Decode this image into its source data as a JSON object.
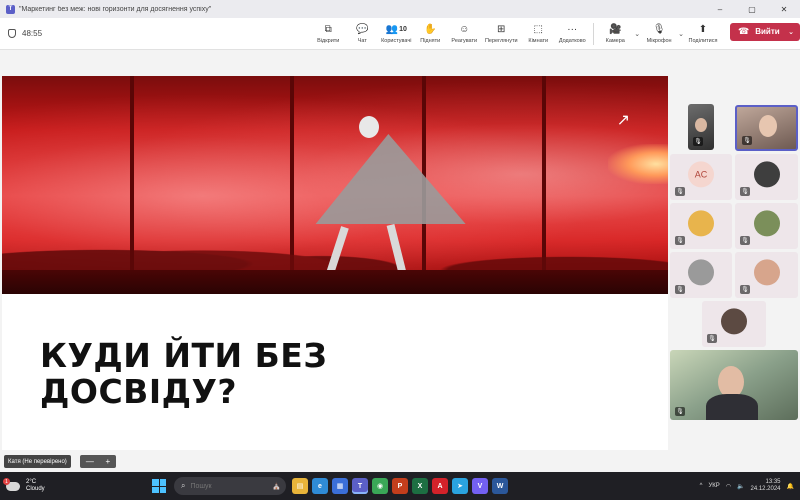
{
  "window": {
    "title": "\"Маркетинг без меж: нові горизонти для досягнення успіху\"",
    "controls": {
      "minimize": "–",
      "maximize": "▢",
      "close": "✕"
    }
  },
  "toolbar": {
    "timer": "48:55",
    "items": [
      {
        "id": "open",
        "label": "Відкрити",
        "icon": "open-in-window-icon",
        "glyph": "⧉"
      },
      {
        "id": "chat",
        "label": "Чат",
        "icon": "chat-icon",
        "glyph": "💬"
      },
      {
        "id": "people",
        "label": "Користувачі",
        "icon": "people-icon",
        "glyph": "👥",
        "count": "10"
      },
      {
        "id": "raise",
        "label": "Підняти",
        "icon": "raise-hand-icon",
        "glyph": "✋"
      },
      {
        "id": "react",
        "label": "Реагувати",
        "icon": "smile-icon",
        "glyph": "☺"
      },
      {
        "id": "view",
        "label": "Переглянути",
        "icon": "grid-view-icon",
        "glyph": "⊞"
      },
      {
        "id": "rooms",
        "label": "Кімнати",
        "icon": "rooms-icon",
        "glyph": "⬚"
      },
      {
        "id": "more",
        "label": "Додатково",
        "icon": "more-icon",
        "glyph": "···"
      }
    ],
    "camera": {
      "label": "Камера",
      "icon": "camera-icon",
      "glyph": "🎥"
    },
    "mic": {
      "label": "Мікрофон",
      "icon": "mic-off-icon",
      "glyph": "🎙"
    },
    "share": {
      "label": "Поділитися",
      "icon": "share-icon",
      "glyph": "⬆"
    },
    "leave": {
      "label": "Вийти",
      "icon": "phone-hangup-icon",
      "glyph": "☎",
      "color": "#c4314b"
    }
  },
  "slide": {
    "title": "КУДИ ЙТИ БЕЗ\nДОСВІДУ?",
    "accent_color": "#d61f1f"
  },
  "participants": [
    {
      "id": "p1",
      "type": "camera",
      "mic": "muted"
    },
    {
      "id": "p2",
      "type": "camera",
      "mic": "muted",
      "selected": true
    },
    {
      "id": "p3",
      "type": "initials",
      "initials": "AC",
      "mic": "muted"
    },
    {
      "id": "p4",
      "type": "avatar",
      "mic": "muted"
    },
    {
      "id": "p5",
      "type": "avatar",
      "mic": "muted"
    },
    {
      "id": "p6",
      "type": "avatar",
      "mic": "muted"
    },
    {
      "id": "p7",
      "type": "avatar",
      "mic": "muted"
    },
    {
      "id": "p8",
      "type": "avatar",
      "mic": "muted"
    },
    {
      "id": "p9",
      "type": "avatar",
      "mic": "muted"
    },
    {
      "id": "p10",
      "type": "camera",
      "mic": "muted"
    }
  ],
  "meeting_bar": {
    "presenter_chip": "Катя (Не перевірено)",
    "zoom_out": "—",
    "zoom_in": "+"
  },
  "taskbar": {
    "weather": {
      "temp": "2°C",
      "condition": "Cloudy",
      "badge": "1"
    },
    "search_placeholder": "Пошук",
    "apps": [
      {
        "name": "file-explorer-app",
        "color": "#e8b43a",
        "glyph": "▤"
      },
      {
        "name": "edge-app",
        "color": "#2f8bd6",
        "glyph": "e"
      },
      {
        "name": "store-app",
        "color": "#3b6fd8",
        "glyph": "▦"
      },
      {
        "name": "teams-app",
        "color": "#5b5fc7",
        "glyph": "T"
      },
      {
        "name": "chrome-app",
        "color": "#3aa757",
        "glyph": "◉"
      },
      {
        "name": "powerpoint-app",
        "color": "#c43e1c",
        "glyph": "P"
      },
      {
        "name": "excel-app",
        "color": "#1d6f42",
        "glyph": "X"
      },
      {
        "name": "acrobat-app",
        "color": "#d3222a",
        "glyph": "A"
      },
      {
        "name": "telegram-app",
        "color": "#2aa3df",
        "glyph": "➤"
      },
      {
        "name": "viber-app",
        "color": "#7360f2",
        "glyph": "V"
      },
      {
        "name": "word-app",
        "color": "#2b579a",
        "glyph": "W"
      }
    ],
    "tray": {
      "language": "УКР",
      "time": "13:35",
      "date": "24.12.2024"
    }
  }
}
